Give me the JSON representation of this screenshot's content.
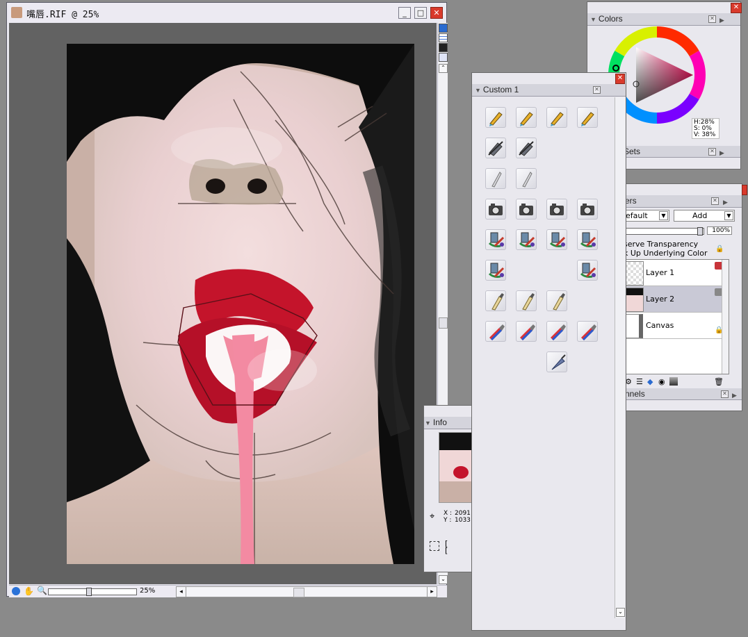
{
  "document": {
    "title": "嘴唇.RIF @ 25%",
    "zoom_label": "25%",
    "zoom_fraction": 0.45
  },
  "colors_panel": {
    "title": "Colors",
    "h": "H:28%",
    "s": "S: 0%",
    "v": "V: 38%",
    "sets_label": "Sets"
  },
  "custom_panel": {
    "title": "Custom  1",
    "tool_rows": [
      [
        "pencil-icon",
        "pencil-icon",
        "pencil-icon",
        "pencil-icon"
      ],
      [
        "eraser-icon",
        "eraser-icon"
      ],
      [
        "blender-icon",
        "blender-icon"
      ],
      [
        "camera-icon",
        "camera-icon",
        "camera-icon",
        "camera-icon"
      ],
      [
        "artist-brush-icon",
        "artist-brush-icon",
        "artist-brush-icon",
        "artist-brush-icon"
      ],
      [
        "artist-brush-icon",
        "",
        "",
        "artist-brush-icon"
      ],
      [
        "flat-brush-icon",
        "flat-brush-icon",
        "flat-brush-icon"
      ],
      [
        "striped-brush-icon",
        "striped-brush-icon",
        "striped-brush-icon",
        "striped-brush-icon"
      ],
      [
        "",
        "",
        "palette-knife-icon"
      ]
    ]
  },
  "layers_panel": {
    "title": "ers",
    "composite_method": "efault",
    "composite_depth": "Add",
    "opacity": "100%",
    "opacity_fraction": 0.98,
    "preserve_transparency": "serve Transparency",
    "pick_up_underlying": "k Up Underlying Color",
    "layers": [
      {
        "name": "Layer 1",
        "selected": false
      },
      {
        "name": "Layer 2",
        "selected": true
      },
      {
        "name": "Canvas",
        "selected": false
      }
    ],
    "channels_label": "nnels"
  },
  "info_panel": {
    "title": "Info",
    "x_label": "X :",
    "x_value": "2091",
    "y_label": "Y :",
    "y_value": "1033",
    "w_label": "[",
    "h_label": "["
  },
  "theme": {
    "accent_red": "#d93a2c",
    "panel_bg": "#e9e8ee",
    "selected_layer": "#c9c9d6"
  }
}
